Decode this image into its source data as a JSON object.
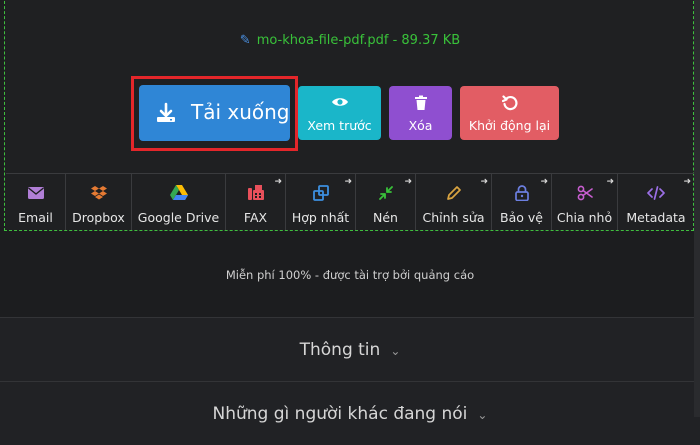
{
  "file": {
    "name_size": "mo-khoa-file-pdf.pdf - 89.37 KB"
  },
  "actions": {
    "download": "Tải xuống",
    "preview": "Xem trước",
    "delete": "Xóa",
    "restart": "Khởi động lại"
  },
  "tools": [
    {
      "label": "Email",
      "icon": "envelope-icon",
      "color": "#b07ed6"
    },
    {
      "label": "Dropbox",
      "icon": "dropbox-icon",
      "color": "#e57a33"
    },
    {
      "label": "Google Drive",
      "icon": "google-drive-icon",
      "color": "#34a853"
    },
    {
      "label": "FAX",
      "icon": "fax-icon",
      "color": "#e8505b"
    },
    {
      "label": "Hợp nhất",
      "icon": "merge-icon",
      "color": "#3c8fe0"
    },
    {
      "label": "Nén",
      "icon": "compress-icon",
      "color": "#39c13a"
    },
    {
      "label": "Chỉnh sửa",
      "icon": "pencil-icon",
      "color": "#d9a441"
    },
    {
      "label": "Bảo vệ",
      "icon": "lock-icon",
      "color": "#6c7fe0"
    },
    {
      "label": "Chia nhỏ",
      "icon": "scissors-icon",
      "color": "#c85ed0"
    },
    {
      "label": "Metadata",
      "icon": "code-icon",
      "color": "#9b6fe6"
    }
  ],
  "sponsor": "Miễn phí 100% - được tài trợ bởi quảng cáo",
  "sections": {
    "info": "Thông tin",
    "reviews": "Những gì người khác đang nói"
  }
}
